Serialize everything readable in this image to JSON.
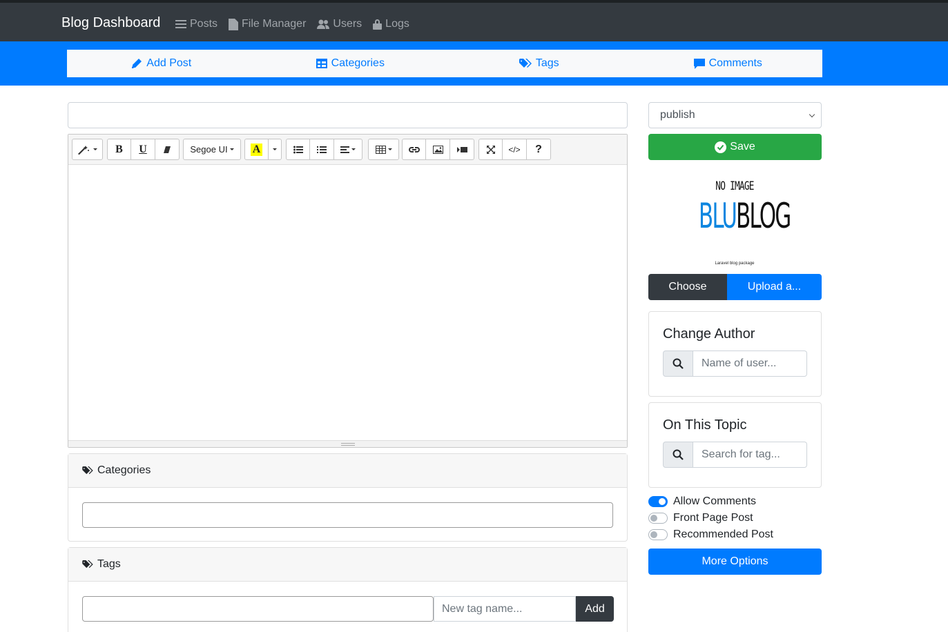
{
  "navbar": {
    "brand": "Blog Dashboard",
    "links": [
      {
        "label": "Posts",
        "icon": "list-icon"
      },
      {
        "label": "File Manager",
        "icon": "file-icon"
      },
      {
        "label": "Users",
        "icon": "users-icon"
      },
      {
        "label": "Logs",
        "icon": "lock-icon"
      }
    ]
  },
  "subnav": {
    "items": [
      {
        "label": "Add Post",
        "icon": "pencil-icon"
      },
      {
        "label": "Categories",
        "icon": "table-icon"
      },
      {
        "label": "Tags",
        "icon": "tags-icon"
      },
      {
        "label": "Comments",
        "icon": "comment-icon"
      }
    ]
  },
  "editor": {
    "title_value": "",
    "toolbar": {
      "font_name": "Segoe UI",
      "bold": "B",
      "underline": "U",
      "help": "?",
      "code": "</>",
      "color_letter": "A"
    }
  },
  "categories_card": {
    "title": "Categories",
    "input_value": ""
  },
  "tags_card": {
    "title": "Tags",
    "input_value": "",
    "new_tag_placeholder": "New tag name...",
    "add_label": "Add"
  },
  "sidebar": {
    "status_value": "publish",
    "save_label": "Save",
    "preview": {
      "no_image": "NO IMAGE",
      "logo_blu": "BLU",
      "logo_blog": "BLOG",
      "tagline": "Laravel blog package"
    },
    "choose_label": "Choose",
    "upload_label": "Upload a...",
    "change_author": {
      "title": "Change Author",
      "placeholder": "Name of user..."
    },
    "on_this_topic": {
      "title": "On This Topic",
      "placeholder": "Search for tag..."
    },
    "switches": [
      {
        "label": "Allow Comments",
        "on": true
      },
      {
        "label": "Front Page Post",
        "on": false
      },
      {
        "label": "Recommended Post",
        "on": false
      }
    ],
    "more_options_label": "More Options"
  },
  "colors": {
    "navbar": "#343a40",
    "primary": "#007bff",
    "success": "#28a745",
    "dark": "#343a40"
  }
}
